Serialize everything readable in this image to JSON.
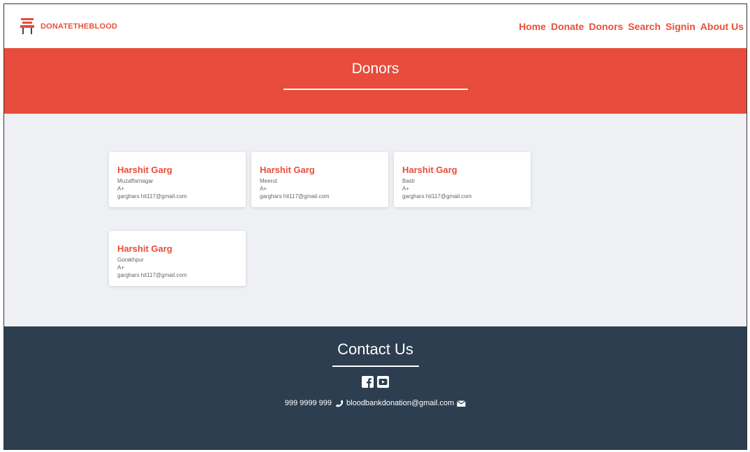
{
  "brand": {
    "name": "DONATETHEBLOOD",
    "logo_icon": "blood-bag-icon"
  },
  "nav": [
    {
      "label": "Home"
    },
    {
      "label": "Donate"
    },
    {
      "label": "Donors"
    },
    {
      "label": "Search"
    },
    {
      "label": "Signin"
    },
    {
      "label": "About Us"
    }
  ],
  "banner": {
    "title": "Donors"
  },
  "donors": [
    {
      "name": "Harshit Garg",
      "city": "Muzaffarnagar",
      "blood_group": "A+",
      "email": "garghars hit117@gmail.com"
    },
    {
      "name": "Harshit Garg",
      "city": "Meerut",
      "blood_group": "A+",
      "email": "garghars hit117@gmail.com"
    },
    {
      "name": "Harshit Garg",
      "city": "Basti",
      "blood_group": "A+",
      "email": "garghars hit117@gmail.com"
    },
    {
      "name": "Harshit Garg",
      "city": "Gorakhpur",
      "blood_group": "A+",
      "email": "garghars hit117@gmail.com"
    }
  ],
  "footer": {
    "title": "Contact Us",
    "social_icons": [
      "facebook-icon",
      "youtube-icon"
    ],
    "phone": "999 9999 999",
    "email": "bloodbankdonation@gmail.com"
  },
  "colors": {
    "accent": "#e74c3c",
    "footer_bg": "#2c3e50",
    "page_bg": "#eef0f3"
  }
}
